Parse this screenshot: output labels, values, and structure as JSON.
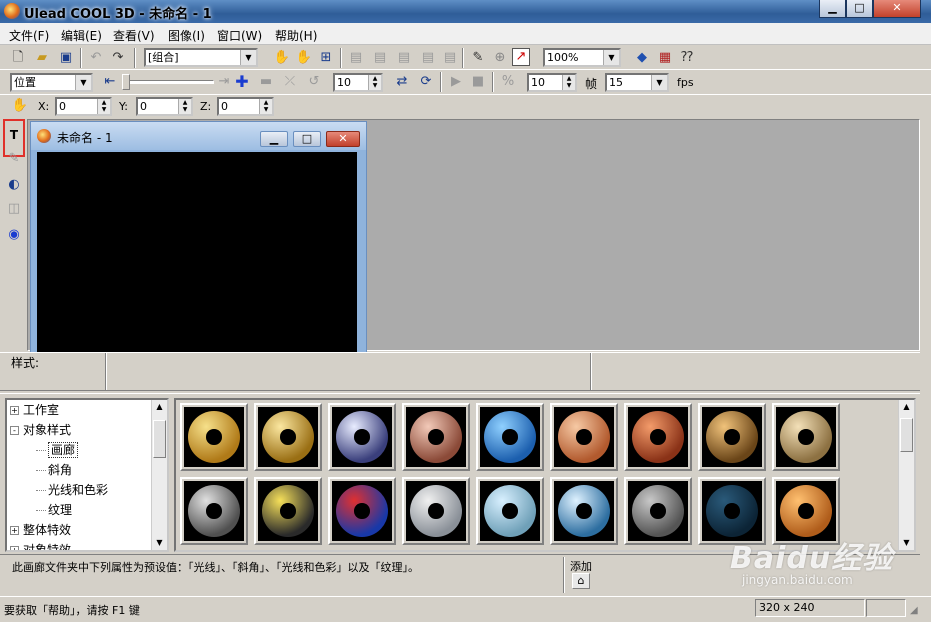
{
  "window": {
    "title": "Ulead COOL 3D - 未命名 - 1",
    "min": "▁",
    "max": "□",
    "close": "✕"
  },
  "menu": [
    "文件(F)",
    "编辑(E)",
    "查看(V)",
    "图像(I)",
    "窗口(W)",
    "帮助(H)"
  ],
  "toolbar1": {
    "object_select": "[组合]",
    "zoom": "100%"
  },
  "toolbar2": {
    "attribute": "位置",
    "frame_value": "10",
    "frame_count": "10",
    "frame_label": "帧",
    "fps_value": "15",
    "fps_label": "fps"
  },
  "toolbar3": {
    "x_label": "X:",
    "x": "0",
    "y_label": "Y:",
    "y": "0",
    "z_label": "Z:",
    "z": "0"
  },
  "child_window": {
    "title": "未命名 - 1"
  },
  "style_panel": {
    "label": "样式:"
  },
  "tree": [
    {
      "label": "工作室",
      "expander": "+",
      "level": 0
    },
    {
      "label": "对象样式",
      "expander": "-",
      "level": 0
    },
    {
      "label": "画廊",
      "level": 1,
      "selected": true
    },
    {
      "label": "斜角",
      "level": 1
    },
    {
      "label": "光线和色彩",
      "level": 1
    },
    {
      "label": "纹理",
      "level": 1
    },
    {
      "label": "整体特效",
      "expander": "+",
      "level": 0
    },
    {
      "label": "对象特效",
      "expander": "+",
      "level": 0
    }
  ],
  "gallery": {
    "thumbs": [
      {
        "c1": "#f6e08a",
        "c2": "#b07a18"
      },
      {
        "c1": "#fbe7a0",
        "c2": "#9a6f14"
      },
      {
        "c1": "#e8ecff",
        "c2": "#3a3f7c"
      },
      {
        "c1": "#f2c9b8",
        "c2": "#8b4a38"
      },
      {
        "c1": "#8fd0ff",
        "c2": "#1c5fae"
      },
      {
        "c1": "#f6c9a4",
        "c2": "#b25a2e"
      },
      {
        "c1": "#f39b6a",
        "c2": "#8a3217"
      },
      {
        "c1": "#f0c27a",
        "c2": "#6a4518"
      },
      {
        "c1": "#f3e0b8",
        "c2": "#8d7142"
      },
      {
        "c1": "#e0e0e0",
        "c2": "#505050"
      },
      {
        "c1": "#f6e05a",
        "c2": "#2a2a2a"
      },
      {
        "c1": "#e03030",
        "c2": "#1838a8"
      },
      {
        "c1": "#f0f0f0",
        "c2": "#8a9098"
      },
      {
        "c1": "#d8f0ff",
        "c2": "#6fa0b8"
      },
      {
        "c1": "#dff2ff",
        "c2": "#2d6ea0"
      },
      {
        "c1": "#c8c8c8",
        "c2": "#555"
      },
      {
        "c1": "#2a5a7a",
        "c2": "#0c2436"
      },
      {
        "c1": "#ffc070",
        "c2": "#b05d1b"
      }
    ]
  },
  "description": "此画廊文件夹中下列属性为预设值：「光线」、「斜角」、「光线和色彩」以及「纹理」。",
  "add_label": "添加",
  "status": {
    "help": "要获取「帮助」，请按 F1 键",
    "size": "320 x 240"
  },
  "watermark": {
    "text": "Baidu经验",
    "sub": "jingyan.baidu.com"
  }
}
